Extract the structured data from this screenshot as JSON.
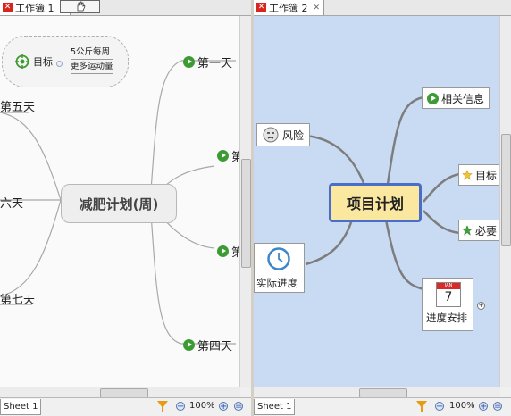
{
  "left_pane": {
    "tab_label": "工作簿 1",
    "central": "减肥计划(周)",
    "nodes": {
      "day1": "第一天",
      "day4": "第四天",
      "day5": "第五天",
      "day6": "六天",
      "day7": "第七天",
      "partial_upper": "第",
      "partial_lower": "第"
    },
    "floating": {
      "goal": "目标",
      "item1": "5公斤每周",
      "item2": "更多运动量"
    },
    "sheet": "Sheet 1",
    "zoom": "100%"
  },
  "right_pane": {
    "tab_label": "工作簿 2",
    "central": "项目计划",
    "nodes": {
      "risk": "风险",
      "actual": "实际进度",
      "related": "相关信息",
      "goal": "目标",
      "needed": "必要",
      "schedule": "进度安排",
      "calendar_day": "7",
      "calendar_header": "JAN"
    },
    "sheet": "Sheet 1",
    "zoom": "100%"
  },
  "colors": {
    "right_canvas": "#c9daf3",
    "central_fill": "#fae8a0",
    "central_border": "#4a6ec8",
    "branch_green": "#3d9b33"
  }
}
